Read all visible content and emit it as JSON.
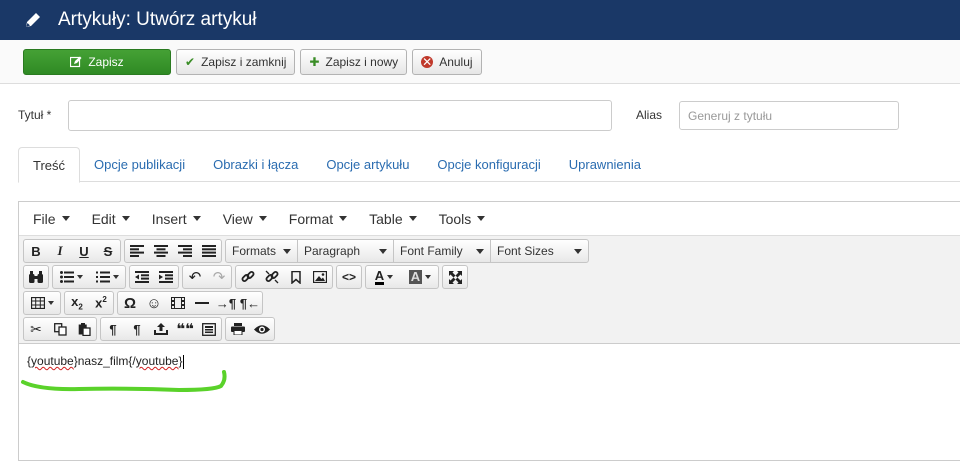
{
  "header": {
    "title": "Artykuły: Utwórz artykuł",
    "icon": "pencil-icon"
  },
  "toolbar": {
    "save": "Zapisz",
    "save_close": "Zapisz i zamknij",
    "save_new": "Zapisz i nowy",
    "cancel": "Anuluj"
  },
  "form": {
    "title_label": "Tytuł *",
    "title_value": "",
    "alias_label": "Alias",
    "alias_placeholder": "Generuj z tytułu"
  },
  "tabs": [
    {
      "label": "Treść",
      "active": true
    },
    {
      "label": "Opcje publikacji"
    },
    {
      "label": "Obrazki i łącza"
    },
    {
      "label": "Opcje artykułu"
    },
    {
      "label": "Opcje konfiguracji"
    },
    {
      "label": "Uprawnienia"
    }
  ],
  "editor": {
    "menus": [
      "File",
      "Edit",
      "Insert",
      "View",
      "Format",
      "Table",
      "Tools"
    ],
    "selects": {
      "formats": "Formats",
      "paragraph": "Paragraph",
      "font_family": "Font Family",
      "font_sizes": "Font Sizes"
    },
    "buttons": {
      "bold": "B",
      "italic": "I",
      "underline": "U",
      "strike": "S",
      "text_color": "A",
      "bg_color": "A"
    },
    "content": {
      "open_brace": "{",
      "word1": "youtube",
      "middle": "}nasz_film{/",
      "word2": "youtube",
      "close_brace": "}"
    }
  },
  "colors": {
    "header_bg": "#1a3867",
    "save_btn": "#3a9a2b",
    "link": "#2a6cb0",
    "annotation": "#5ad22a"
  }
}
